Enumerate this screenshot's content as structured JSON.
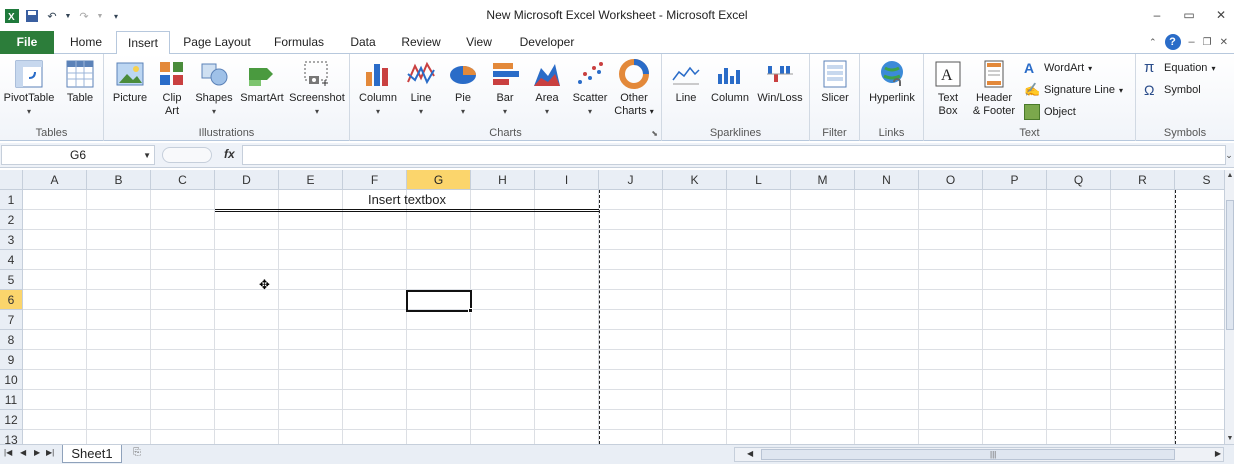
{
  "window": {
    "title": "New Microsoft Excel Worksheet  -  Microsoft Excel",
    "controls": [
      "–",
      "▭",
      "✕"
    ]
  },
  "tabs": {
    "file": "File",
    "items": [
      "Home",
      "Insert",
      "Page Layout",
      "Formulas",
      "Data",
      "Review",
      "View",
      "Developer"
    ],
    "active": "Insert"
  },
  "ribbon": {
    "tables": {
      "label": "Tables",
      "pivot": "PivotTable",
      "table": "Table"
    },
    "illustrations": {
      "label": "Illustrations",
      "picture": "Picture",
      "clipart_1": "Clip",
      "clipart_2": "Art",
      "shapes": "Shapes",
      "smartart": "SmartArt",
      "screenshot": "Screenshot"
    },
    "charts": {
      "label": "Charts",
      "column": "Column",
      "line": "Line",
      "pie": "Pie",
      "bar": "Bar",
      "area": "Area",
      "scatter": "Scatter",
      "other_1": "Other",
      "other_2": "Charts"
    },
    "sparklines": {
      "label": "Sparklines",
      "line": "Line",
      "column": "Column",
      "winloss": "Win/Loss"
    },
    "filter": {
      "label": "Filter",
      "slicer": "Slicer"
    },
    "links": {
      "label": "Links",
      "hyperlink": "Hyperlink"
    },
    "text": {
      "label": "Text",
      "textbox_1": "Text",
      "textbox_2": "Box",
      "header_1": "Header",
      "header_2": "& Footer",
      "wordart": "WordArt",
      "signature": "Signature Line",
      "object": "Object"
    },
    "symbols": {
      "label": "Symbols",
      "equation": "Equation",
      "symbol": "Symbol"
    }
  },
  "formula_bar": {
    "name_box": "G6",
    "fx": "fx",
    "value": ""
  },
  "grid": {
    "columns": [
      "A",
      "B",
      "C",
      "D",
      "E",
      "F",
      "G",
      "H",
      "I",
      "J",
      "K",
      "L",
      "M",
      "N",
      "O",
      "P",
      "Q",
      "R",
      "S"
    ],
    "rows": [
      "1",
      "2",
      "3",
      "4",
      "5",
      "6",
      "7",
      "8",
      "9",
      "10",
      "11",
      "12",
      "13"
    ],
    "selected_column": "G",
    "selected_row": "6",
    "textbox_text": "Insert textbox"
  },
  "sheets": {
    "items": [
      "Sheet1"
    ]
  }
}
